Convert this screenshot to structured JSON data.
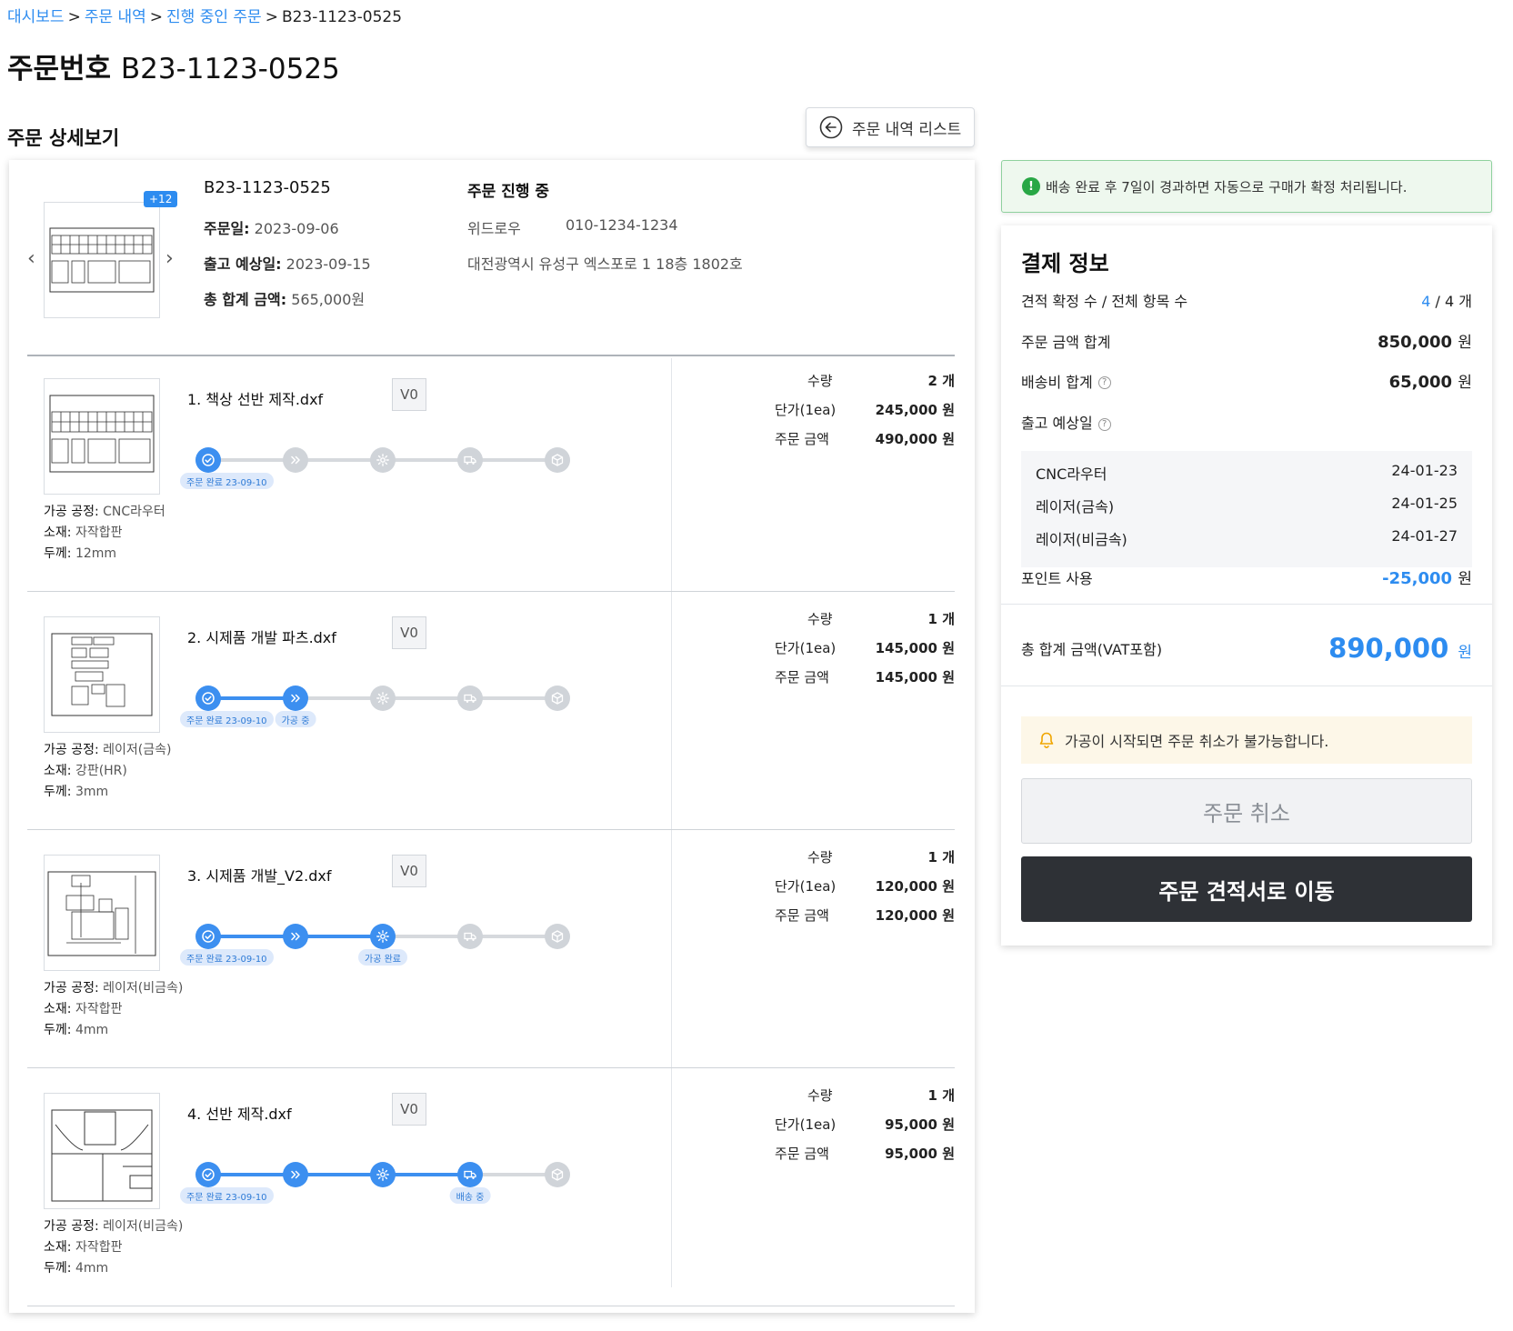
{
  "breadcrumb": {
    "items": [
      "대시보드",
      "주문 내역",
      "진행 중인 주문"
    ],
    "current": "B23-1123-0525",
    "separator": ">"
  },
  "page": {
    "title_label": "주문번호",
    "title_number": "B23-1123-0525",
    "section_title": "주문 상세보기",
    "back_button": "주문 내역 리스트"
  },
  "summary": {
    "thumb_badge": "+12",
    "order_no": "B23-1123-0525",
    "status": "주문 진행 중",
    "order_date_label": "주문일:",
    "order_date": "2023-09-06",
    "ship_date_label": "출고 예상일:",
    "ship_date": "2023-09-15",
    "total_label": "총 합계 금액:",
    "total": "565,000원",
    "company": "위드로우",
    "phone": "010-1234-1234",
    "address": "대전광역시 유성구 엑스포로 1 18층 1802호"
  },
  "labels": {
    "process": "가공 공정:",
    "material": "소재:",
    "thickness": "두께:",
    "qty": "수량",
    "unit_price": "단가(1ea)",
    "amount": "주문 금액"
  },
  "items": [
    {
      "name": "1. 책상 선반 제작.dxf",
      "version": "V0",
      "process": "CNC라우터",
      "material": "자작합판",
      "thickness": "12mm",
      "qty": "2 개",
      "unit_price": "245,000 원",
      "amount": "490,000 원",
      "active_steps": 1,
      "pill_done": "주문 완료  23-09-10",
      "pill_extra": ""
    },
    {
      "name": "2. 시제품 개발 파츠.dxf",
      "version": "V0",
      "process": "레이저(금속)",
      "material": "강판(HR)",
      "thickness": "3mm",
      "qty": "1 개",
      "unit_price": "145,000 원",
      "amount": "145,000 원",
      "active_steps": 2,
      "pill_done": "주문 완료  23-09-10",
      "pill_extra": "가공 중"
    },
    {
      "name": "3. 시제품 개발_V2.dxf",
      "version": "V0",
      "process": "레이저(비금속)",
      "material": "자작합판",
      "thickness": "4mm",
      "qty": "1 개",
      "unit_price": "120,000 원",
      "amount": "120,000 원",
      "active_steps": 3,
      "pill_done": "주문 완료  23-09-10",
      "pill_extra": "가공 완료"
    },
    {
      "name": "4. 선반 제작.dxf",
      "version": "V0",
      "process": "레이저(비금속)",
      "material": "자작합판",
      "thickness": "4mm",
      "qty": "1 개",
      "unit_price": "95,000 원",
      "amount": "95,000 원",
      "active_steps": 4,
      "pill_done": "주문 완료  23-09-10",
      "pill_extra": "배송 중"
    }
  ],
  "notice_green": "배송 완료 후 7일이 경과하면 자동으로 구매가 확정 처리됩니다.",
  "payment": {
    "title": "결제 정보",
    "confirm_label": "견적 확정 수 / 전체 항목 수",
    "confirm_count": "4",
    "confirm_total": "/ 4 개",
    "order_sum_label": "주문 금액 합계",
    "order_sum": "850,000",
    "ship_fee_label": "배송비 합계",
    "ship_fee": "65,000",
    "ship_date_label": "출고 예상일",
    "unit": "원",
    "dates": [
      {
        "name": "CNC라우터",
        "date": "24-01-23"
      },
      {
        "name": "레이저(금속)",
        "date": "24-01-25"
      },
      {
        "name": "레이저(비금속)",
        "date": "24-01-27"
      }
    ],
    "point_label": "포인트 사용",
    "point": "-25,000",
    "total_label": "총 합계 금액(VAT포함)",
    "total": "890,000",
    "notice_yellow": "가공이 시작되면 주문 취소가 불가능합니다.",
    "cancel_button": "주문 취소",
    "quote_button": "주문 견적서로 이동"
  },
  "colors": {
    "accent": "#2d8cf0",
    "step_active": "#3c8ff0",
    "step_inactive": "#d0d4d9",
    "dark_button": "#2e3136"
  },
  "icons": [
    "arrow-left-circle-icon",
    "chevron-left-icon",
    "chevron-right-icon",
    "check-circle-icon",
    "double-chevron-icon",
    "gear-icon",
    "truck-icon",
    "box-icon",
    "alert-icon",
    "bell-icon",
    "help-icon"
  ]
}
